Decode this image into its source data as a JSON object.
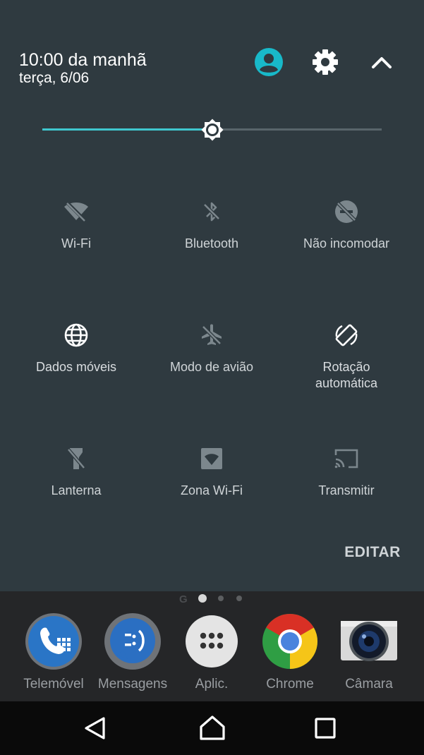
{
  "header": {
    "time": "10:00 da manhã",
    "date": "terça, 6/06"
  },
  "brightness": {
    "level": 0.5
  },
  "tiles": [
    {
      "label": "Wi-Fi",
      "icon": "wifi-off-icon",
      "active": false
    },
    {
      "label": "Bluetooth",
      "icon": "bluetooth-off-icon",
      "active": false
    },
    {
      "label": "Não incomodar",
      "icon": "do-not-disturb-off-icon",
      "active": false
    },
    {
      "label": "Dados móveis",
      "icon": "globe-icon",
      "active": true
    },
    {
      "label": "Modo de avião",
      "icon": "airplane-off-icon",
      "active": false
    },
    {
      "label": "Rotação automática",
      "icon": "auto-rotate-icon",
      "active": true
    },
    {
      "label": "Lanterna",
      "icon": "flashlight-off-icon",
      "active": false
    },
    {
      "label": "Zona Wi-Fi",
      "icon": "hotspot-icon",
      "active": false
    },
    {
      "label": "Transmitir",
      "icon": "cast-icon",
      "active": false
    }
  ],
  "edit_label": "EDITAR",
  "page_indicator": {
    "google_letter": "G",
    "pages": 3,
    "current": 0
  },
  "dock": [
    {
      "label": "Telemóvel",
      "icon": "phone-app-icon"
    },
    {
      "label": "Mensagens",
      "icon": "messages-app-icon"
    },
    {
      "label": "Aplic.",
      "icon": "app-drawer-icon"
    },
    {
      "label": "Chrome",
      "icon": "chrome-app-icon"
    },
    {
      "label": "Câmara",
      "icon": "camera-app-icon"
    }
  ],
  "colors": {
    "panel_bg": "#2f3a40",
    "accent": "#3fc7cf",
    "active_icon": "#ffffff",
    "inactive_icon": "#7c878d"
  }
}
